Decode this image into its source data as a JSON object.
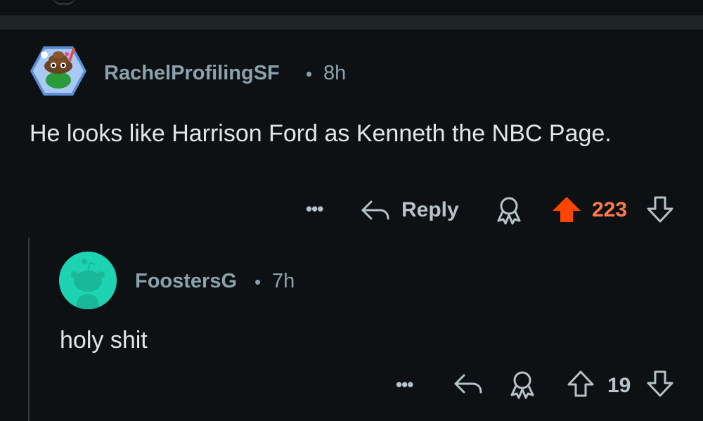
{
  "comments": [
    {
      "author": "RachelProfilingSF",
      "separator": "•",
      "age": "8h",
      "body": "He looks like Harrison Ford as Kenneth the NBC Page.",
      "more_label": "•••",
      "reply_label": "Reply",
      "score": "223",
      "vote_state": "upvoted",
      "avatar_icon": "poop-avatar-icon",
      "score_color": "#ff7a4d",
      "upvote_color": "#ff4500"
    },
    {
      "author": "FoostersG",
      "separator": "•",
      "age": "7h",
      "body": "holy shit",
      "more_label": "•••",
      "reply_label": "",
      "score": "19",
      "vote_state": "none",
      "avatar_icon": "snoo-avatar-icon",
      "avatar_color": "#1ed3b1"
    }
  ]
}
